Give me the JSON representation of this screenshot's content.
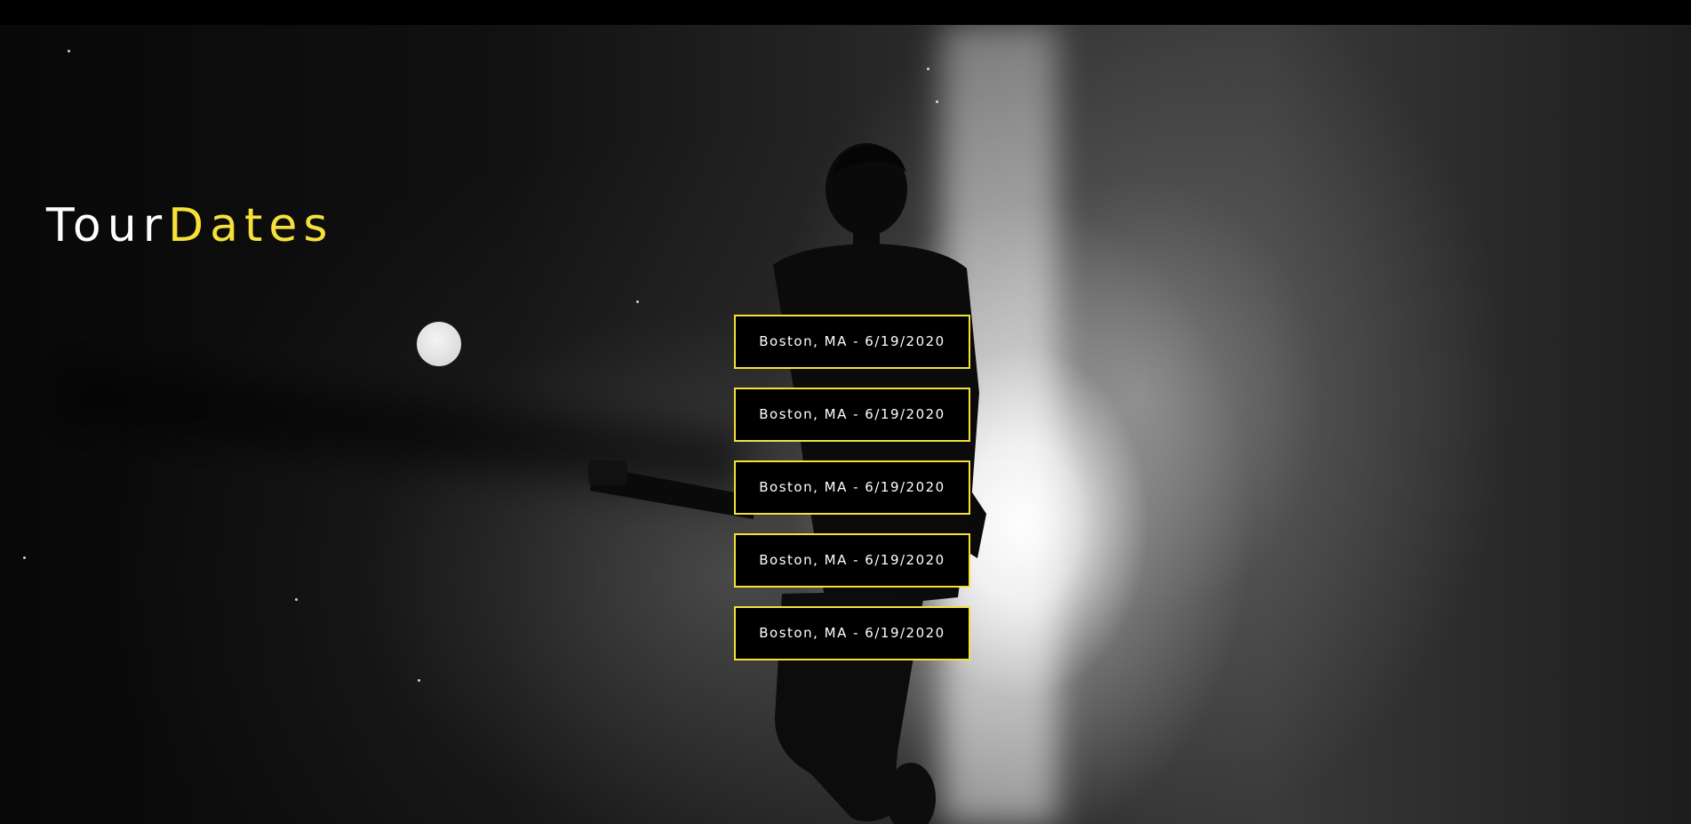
{
  "title": {
    "word1": "Tour",
    "word2": "Dates"
  },
  "dates": [
    {
      "label": "Boston, MA - 6/19/2020"
    },
    {
      "label": "Boston, MA - 6/19/2020"
    },
    {
      "label": "Boston, MA - 6/19/2020"
    },
    {
      "label": "Boston, MA - 6/19/2020"
    },
    {
      "label": "Boston, MA - 6/19/2020"
    }
  ],
  "colors": {
    "accent": "#f5e13a",
    "background": "#000000",
    "text": "#ffffff"
  },
  "background_image": {
    "name": "concert-guitarist-silhouette"
  }
}
